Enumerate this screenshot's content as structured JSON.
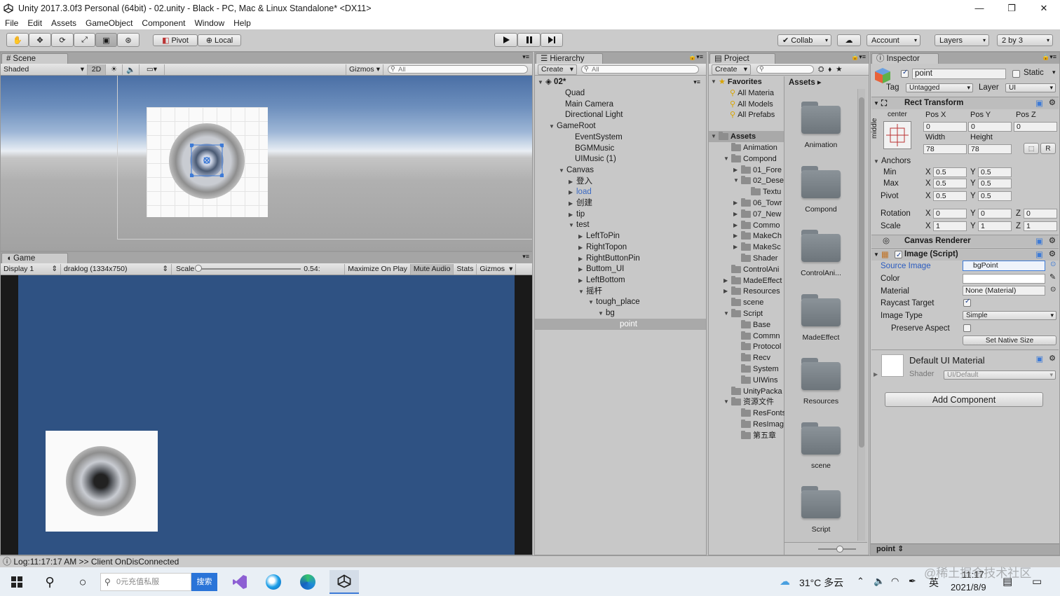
{
  "window": {
    "title": "Unity 2017.3.0f3 Personal (64bit) - 02.unity - Black - PC, Mac & Linux Standalone* <DX11>"
  },
  "menu": [
    "File",
    "Edit",
    "Assets",
    "GameObject",
    "Component",
    "Window",
    "Help"
  ],
  "toolbar": {
    "pivot": "Pivot",
    "local": "Local",
    "collab": "Collab",
    "account": "Account",
    "layers": "Layers",
    "layout": "2 by 3"
  },
  "scene": {
    "tab": "Scene",
    "shading": "Shaded",
    "mode2d": "2D",
    "gizmos": "Gizmos",
    "search_placeholder": "All"
  },
  "game": {
    "tab": "Game",
    "display": "Display 1",
    "resolution": "draklog (1334x750)",
    "scale_label": "Scale",
    "scale_value": "0.54:",
    "scale_fraction": 0.0,
    "maximize": "Maximize On Play",
    "mute": "Mute Audio",
    "stats": "Stats",
    "gizmos": "Gizmos"
  },
  "hierarchy": {
    "tab": "Hierarchy",
    "create": "Create",
    "search_placeholder": "All",
    "root": "02*",
    "items": [
      {
        "label": "Quad",
        "arrow": ""
      },
      {
        "label": "Main Camera",
        "arrow": ""
      },
      {
        "label": "Directional Light",
        "arrow": ""
      },
      {
        "label": "GameRoot",
        "arrow": "▼"
      },
      {
        "label": "EventSystem",
        "arrow": ""
      },
      {
        "label": "BGMMusic",
        "arrow": ""
      },
      {
        "label": "UIMusic (1)",
        "arrow": ""
      },
      {
        "label": "Canvas",
        "arrow": "▼"
      },
      {
        "label": "登入",
        "arrow": "▶"
      },
      {
        "label": "load",
        "arrow": "▶"
      },
      {
        "label": "创建",
        "arrow": "▶"
      },
      {
        "label": "tip",
        "arrow": "▶"
      },
      {
        "label": "test",
        "arrow": "▼"
      },
      {
        "label": "LeftToPin",
        "arrow": "▶"
      },
      {
        "label": "RightTopon",
        "arrow": "▶"
      },
      {
        "label": "RightButtonPin",
        "arrow": "▶"
      },
      {
        "label": "Buttom_UI",
        "arrow": "▶"
      },
      {
        "label": "LeftBottom",
        "arrow": "▶"
      },
      {
        "label": "摇杆",
        "arrow": "▼"
      },
      {
        "label": "tough_place",
        "arrow": "▼"
      },
      {
        "label": "bg",
        "arrow": "▼"
      },
      {
        "label": "point",
        "arrow": ""
      }
    ]
  },
  "project": {
    "tab": "Project",
    "create": "Create",
    "favorites": "Favorites",
    "fav_items": [
      "All Materia",
      "All Models",
      "All Prefabs"
    ],
    "assets_root": "Assets",
    "breadcrumb": "Assets",
    "tree": [
      {
        "label": "Animation",
        "arrow": ""
      },
      {
        "label": "Compond",
        "arrow": "▼"
      },
      {
        "label": "01_Fore",
        "arrow": "▶"
      },
      {
        "label": "02_Dese",
        "arrow": "▼"
      },
      {
        "label": "Textu",
        "arrow": ""
      },
      {
        "label": "06_Towr",
        "arrow": "▶"
      },
      {
        "label": "07_New",
        "arrow": "▶"
      },
      {
        "label": "Commo",
        "arrow": "▶"
      },
      {
        "label": "MakeCh",
        "arrow": "▶"
      },
      {
        "label": "MakeSc",
        "arrow": "▶"
      },
      {
        "label": "Shader",
        "arrow": ""
      },
      {
        "label": "ControlAni",
        "arrow": ""
      },
      {
        "label": "MadeEffect",
        "arrow": "▶"
      },
      {
        "label": "Resources",
        "arrow": "▶"
      },
      {
        "label": "scene",
        "arrow": ""
      },
      {
        "label": "Script",
        "arrow": "▼"
      },
      {
        "label": "Base",
        "arrow": ""
      },
      {
        "label": "Commn",
        "arrow": ""
      },
      {
        "label": "Protocol",
        "arrow": ""
      },
      {
        "label": "Recv",
        "arrow": ""
      },
      {
        "label": "System",
        "arrow": ""
      },
      {
        "label": "UIWins",
        "arrow": ""
      },
      {
        "label": "UnityPacka",
        "arrow": ""
      },
      {
        "label": "资源文件",
        "arrow": "▼"
      },
      {
        "label": "ResFonts",
        "arrow": ""
      },
      {
        "label": "ResImag",
        "arrow": ""
      },
      {
        "label": "第五章",
        "arrow": ""
      }
    ],
    "folders": [
      "Animation",
      "Compond",
      "ControlAni...",
      "MadeEffect",
      "Resources",
      "scene",
      "Script"
    ]
  },
  "inspector": {
    "tab": "Inspector",
    "object_name": "point",
    "static": "Static",
    "tag_label": "Tag",
    "tag": "Untagged",
    "layer_label": "Layer",
    "layer": "UI",
    "rect_transform": {
      "title": "Rect Transform",
      "anchor_h": "center",
      "anchor_v": "middle",
      "posx_label": "Pos X",
      "posy_label": "Pos Y",
      "posz_label": "Pos Z",
      "posx": "0",
      "posy": "0",
      "posz": "0",
      "width_label": "Width",
      "height_label": "Height",
      "width": "78",
      "height": "78",
      "r": "R",
      "anchors_label": "Anchors",
      "min_label": "Min",
      "max_label": "Max",
      "pivot_label": "Pivot",
      "rotation_label": "Rotation",
      "scale_label": "Scale",
      "min_x": "0.5",
      "min_y": "0.5",
      "max_x": "0.5",
      "max_y": "0.5",
      "pivot_x": "0.5",
      "pivot_y": "0.5",
      "rot_x": "0",
      "rot_y": "0",
      "rot_z": "0",
      "scale_x": "1",
      "scale_y": "1",
      "scale_z": "1"
    },
    "canvas_renderer": "Canvas Renderer",
    "image": {
      "title": "Image (Script)",
      "source_label": "Source Image",
      "source": "bgPoint",
      "color_label": "Color",
      "material_label": "Material",
      "material": "None (Material)",
      "raycast_label": "Raycast Target",
      "type_label": "Image Type",
      "type": "Simple",
      "preserve_label": "Preserve Aspect",
      "native_btn": "Set Native Size"
    },
    "material": {
      "name": "Default UI Material",
      "shader_label": "Shader",
      "shader": "UI/Default"
    },
    "add_component": "Add Component",
    "footer": "point"
  },
  "status": {
    "log": "Log:11:17:17 AM >> Client OnDisConnected"
  },
  "taskbar": {
    "search_placeholder": "0元充值私服",
    "search_btn": "搜索",
    "weather": "31°C 多云",
    "ime": "英",
    "time": "11:17",
    "date": "2021/8/9",
    "watermark": "@稀土掘金技术社区"
  },
  "colors": {
    "accent": "#3d7ad6",
    "selected": "#a9a9a9",
    "game_bg": "#2f5283"
  }
}
